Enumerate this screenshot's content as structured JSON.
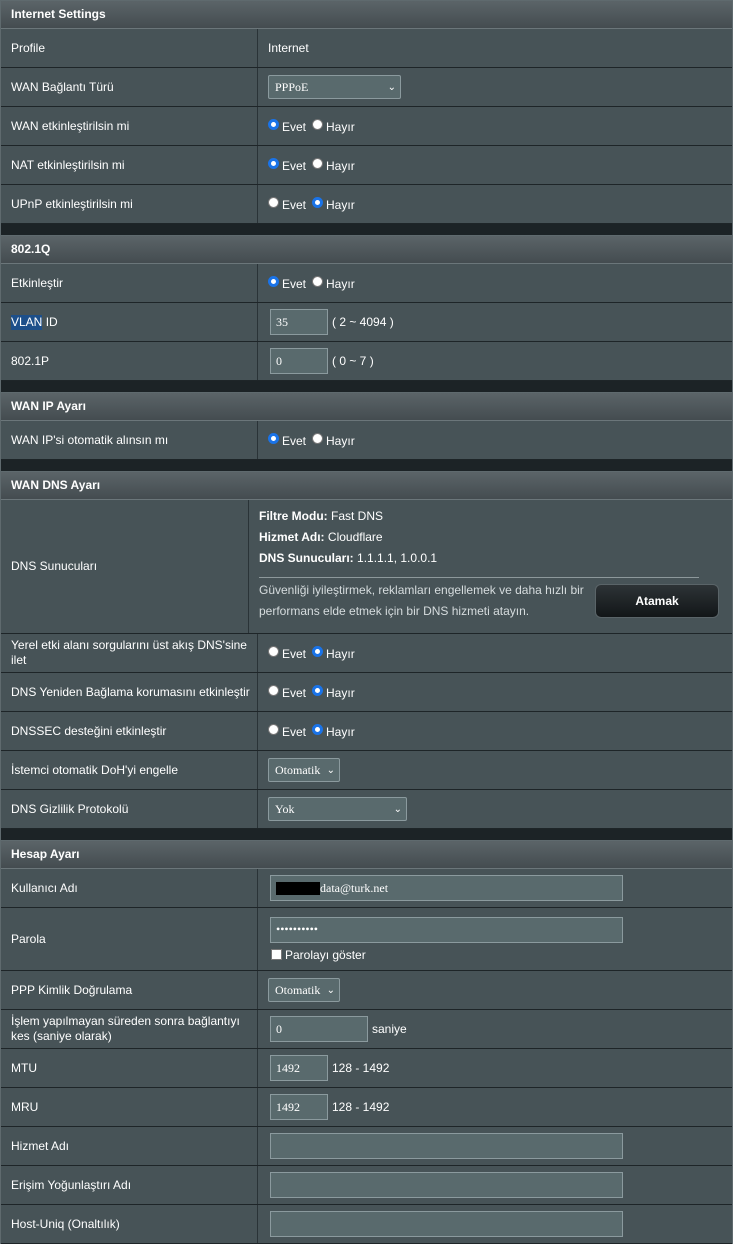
{
  "internet_settings": {
    "header": "Internet Settings",
    "profile": {
      "label": "Profile",
      "value": "Internet"
    },
    "wan_type": {
      "label": "WAN Bağlantı Türü",
      "value": "PPPoE"
    },
    "wan_enable": {
      "label": "WAN etkinleştirilsin mi",
      "yes": "Evet",
      "no": "Hayır",
      "selected": "yes"
    },
    "nat_enable": {
      "label": "NAT etkinleştirilsin mi",
      "yes": "Evet",
      "no": "Hayır",
      "selected": "yes"
    },
    "upnp_enable": {
      "label": "UPnP etkinleştirilsin mi",
      "yes": "Evet",
      "no": "Hayır",
      "selected": "no"
    }
  },
  "dot1q": {
    "header": "802.1Q",
    "enable": {
      "label": "Etkinleştir",
      "yes": "Evet",
      "no": "Hayır",
      "selected": "yes"
    },
    "vlan_id": {
      "label_hl": "VLAN",
      "label_rest": " ID",
      "value": "35",
      "range": "( 2 ~ 4094 )"
    },
    "dot1p": {
      "label": "802.1P",
      "value": "0",
      "range": "( 0 ~ 7 )"
    }
  },
  "wan_ip": {
    "header": "WAN IP Ayarı",
    "auto_ip": {
      "label": "WAN IP'si otomatik alınsın mı",
      "yes": "Evet",
      "no": "Hayır",
      "selected": "yes"
    }
  },
  "wan_dns": {
    "header": "WAN DNS Ayarı",
    "servers": {
      "label": "DNS Sunucuları",
      "filter_key": "Filtre Modu:",
      "filter_val": " Fast DNS",
      "service_key": "Hizmet Adı:",
      "service_val": " Cloudflare",
      "dns_key": "DNS Sunucuları:",
      "dns_val": " 1.1.1.1, 1.0.0.1",
      "desc": "Güvenliği iyileştirmek, reklamları engellemek ve daha hızlı bir performans elde etmek için bir DNS hizmeti atayın.",
      "assign_button": "Atamak"
    },
    "forward_local": {
      "label": "Yerel etki alanı sorgularını üst akış DNS'sine ilet",
      "yes": "Evet",
      "no": "Hayır",
      "selected": "no"
    },
    "rebind": {
      "label": "DNS Yeniden Bağlama korumasını etkinleştir",
      "yes": "Evet",
      "no": "Hayır",
      "selected": "no"
    },
    "dnssec": {
      "label": "DNSSEC desteğini etkinleştir",
      "yes": "Evet",
      "no": "Hayır",
      "selected": "no"
    },
    "doh_block": {
      "label": "İstemci otomatik DoH'yi engelle",
      "value": "Otomatik"
    },
    "privacy": {
      "label": "DNS Gizlilik Protokolü",
      "value": "Yok"
    }
  },
  "account": {
    "header": "Hesap Ayarı",
    "username": {
      "label": "Kullanıcı Adı",
      "value_visible": "data@turk.net"
    },
    "password": {
      "label": "Parola",
      "value": "••••••••••",
      "show_label": "Parolayı göster"
    },
    "auth": {
      "label": "PPP Kimlik Doğrulama",
      "value": "Otomatik"
    },
    "idle": {
      "label": "İşlem yapılmayan süreden sonra bağlantıyı kes (saniye olarak)",
      "value": "0",
      "unit": "saniye"
    },
    "mtu": {
      "label": "MTU",
      "value": "1492",
      "range": "128 - 1492"
    },
    "mru": {
      "label": "MRU",
      "value": "1492",
      "range": "128 - 1492"
    },
    "service_name": {
      "label": "Hizmet Adı",
      "value": ""
    },
    "ac_name": {
      "label": "Erişim Yoğunlaştırı Adı",
      "value": ""
    },
    "host_uniq": {
      "label": "Host-Uniq (Onaltılık)",
      "value": ""
    }
  }
}
